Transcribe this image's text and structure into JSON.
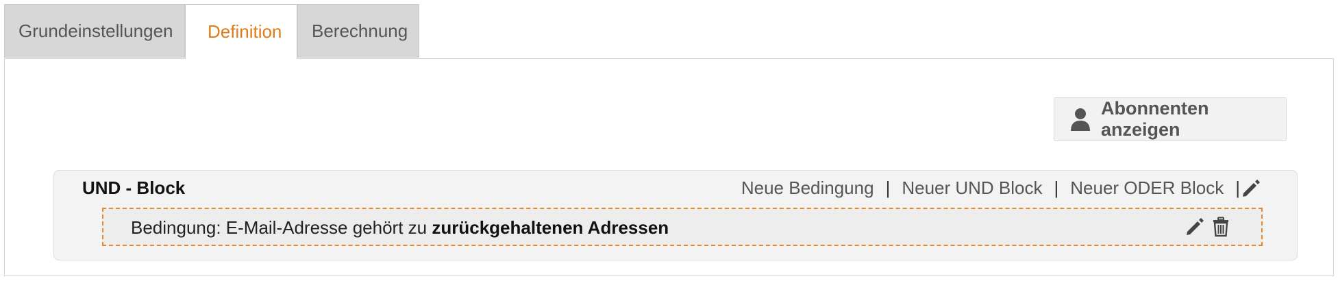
{
  "tabs": [
    {
      "label": "Grundeinstellungen",
      "active": false
    },
    {
      "label": "Definition",
      "active": true
    },
    {
      "label": "Berechnung",
      "active": false
    }
  ],
  "toolbar": {
    "show_subscribers_label": "Abonnenten anzeigen",
    "show_subscribers_icon": "user-icon"
  },
  "block": {
    "title": "UND - Block",
    "actions": {
      "new_condition": "Neue Bedingung",
      "new_and_block": "Neuer UND Block",
      "new_or_block": "Neuer ODER Block",
      "separator": "|"
    },
    "edit_icon": "pencil-icon",
    "condition": {
      "prefix": "Bedingung: E-Mail-Adresse gehört zu ",
      "value": "zurückgehaltenen Adressen",
      "edit_icon": "pencil-icon",
      "delete_icon": "trash-icon"
    }
  },
  "colors": {
    "accent": "#e07b17",
    "condition_border": "#e88a2c",
    "tab_inactive_bg": "#d7d7d7"
  }
}
